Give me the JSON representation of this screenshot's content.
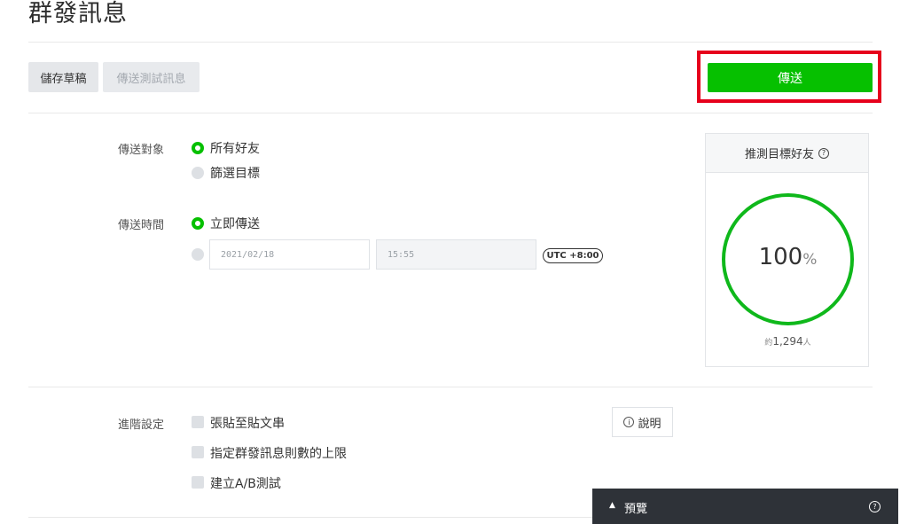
{
  "page": {
    "title": "群發訊息"
  },
  "toolbar": {
    "save_draft_label": "儲存草稿",
    "send_test_label": "傳送測試訊息",
    "send_label": "傳送"
  },
  "form": {
    "target": {
      "label": "傳送對象",
      "options": [
        {
          "label": "所有好友",
          "selected": true
        },
        {
          "label": "篩選目標",
          "selected": false
        }
      ]
    },
    "time": {
      "label": "傳送時間",
      "options": [
        {
          "label": "立即傳送",
          "selected": true
        }
      ],
      "date_placeholder": "2021/02/18",
      "time_placeholder": "15:55",
      "timezone": "UTC +8:00"
    },
    "advanced": {
      "label": "進階設定",
      "checkboxes": [
        {
          "label": "張貼至貼文串",
          "checked": false
        },
        {
          "label": "指定群發訊息則數的上限",
          "checked": false
        },
        {
          "label": "建立A/B測試",
          "checked": false
        }
      ],
      "info_label": "說明"
    }
  },
  "estimate": {
    "title": "推測目標好友",
    "percent_value": "100",
    "percent_unit": "%",
    "approx_prefix": "約",
    "count": "1,294",
    "count_unit": "人"
  },
  "preview": {
    "label": "預覽"
  },
  "colors": {
    "accent_green": "#06c000",
    "ring_green": "#0fb81b",
    "highlight_red": "#e6001c",
    "preview_bar": "#2e3238"
  },
  "icons": {
    "help": "question-circle-icon",
    "info": "info-circle-icon",
    "caret": "caret-up-icon"
  }
}
